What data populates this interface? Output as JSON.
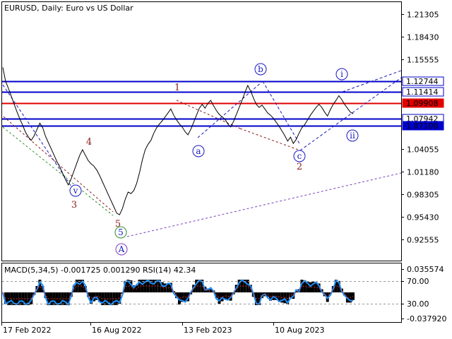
{
  "header": {
    "symbol_title": "EURUSD, Daily:  Euro vs US Dollar"
  },
  "indicator": {
    "title": "MACD(5,34,5) -0.001725 0.001290 RSI(14) 42.34",
    "ticks": [
      {
        "label": "0.035574",
        "value": 0.035574
      },
      {
        "label": "70.00",
        "value": 70
      },
      {
        "label": "30.00",
        "value": 30
      },
      {
        "label": "-0.037920",
        "value": -0.03792
      }
    ]
  },
  "colors": {
    "price_line": "#000000",
    "blue_level": "#0000cc",
    "red_level": "#e00000",
    "macd_histogram": "#000000",
    "rsi_line": "#1e90ff",
    "wave_dark": "#8b1a1a",
    "wave_blue": "#1818c0",
    "channel": "#7b3fbf"
  },
  "chart_data": [
    {
      "type": "line",
      "title": "EURUSD, Daily:  Euro vs US Dollar",
      "x_labels": [
        "17 Feb 2022",
        "16 Aug 2022",
        "13 Feb 2023",
        "10 Aug 2023"
      ],
      "y_ticks": [
        1.21305,
        1.1843,
        1.15555,
        1.04055,
        1.0118,
        0.98305,
        0.9543,
        0.92555
      ],
      "ylim": [
        0.9085,
        1.234
      ],
      "grid": false,
      "series": [
        {
          "values": [
            1.145,
            1.127,
            1.118,
            1.108,
            1.098,
            1.088,
            1.079,
            1.071,
            1.062,
            1.056,
            1.052,
            1.058,
            1.066,
            1.074,
            1.068,
            1.057,
            1.049,
            1.041,
            1.033,
            1.025,
            1.018,
            1.01,
            1.002,
            0.995,
            1.003,
            1.013,
            1.023,
            1.033,
            1.04,
            1.033,
            1.026,
            1.022,
            1.019,
            1.014,
            1.007,
            0.999,
            0.991,
            0.983,
            0.975,
            0.967,
            0.959,
            0.957,
            0.965,
            0.977,
            0.986,
            0.984,
            0.988,
            0.997,
            1.011,
            1.027,
            1.04,
            1.047,
            1.052,
            1.061,
            1.068,
            1.073,
            1.077,
            1.082,
            1.087,
            1.092,
            1.084,
            1.078,
            1.073,
            1.069,
            1.063,
            1.059,
            1.066,
            1.075,
            1.084,
            1.093,
            1.098,
            1.093,
            1.099,
            1.103,
            1.096,
            1.09,
            1.085,
            1.082,
            1.079,
            1.073,
            1.069,
            1.076,
            1.085,
            1.094,
            1.103,
            1.113,
            1.122,
            1.115,
            1.106,
            1.098,
            1.094,
            1.097,
            1.092,
            1.087,
            1.084,
            1.08,
            1.075,
            1.07,
            1.064,
            1.058,
            1.051,
            1.056,
            1.048,
            1.053,
            1.061,
            1.068,
            1.072,
            1.078,
            1.084,
            1.089,
            1.094,
            1.098,
            1.094,
            1.088,
            1.083,
            1.091,
            1.098,
            1.103,
            1.109,
            1.104,
            1.098,
            1.093,
            1.088,
            1.086
          ]
        }
      ],
      "levels": [
        {
          "label": "1.12744",
          "value": 1.12744,
          "color": "#0000cc",
          "tagged": false
        },
        {
          "label": "1.11414",
          "value": 1.11414,
          "color": "#0000cc",
          "tagged": false
        },
        {
          "label": "1.09908",
          "value": 1.09908,
          "color": "#e00000",
          "tagged": true
        },
        {
          "label": "1.07942",
          "value": 1.07942,
          "color": "#0000cc",
          "tagged": false
        },
        {
          "label": "1.07100",
          "value": 1.071,
          "color": "#0000cc",
          "tagged": true
        }
      ],
      "wave_labels": [
        {
          "text": "1",
          "style": "dark"
        },
        {
          "text": "2",
          "style": "dark"
        },
        {
          "text": "3",
          "style": "dark"
        },
        {
          "text": "4",
          "style": "dark"
        },
        {
          "text": "5",
          "style": "dark"
        },
        {
          "text": "5",
          "style": "green-circle"
        },
        {
          "text": "A",
          "style": "purple-circle"
        },
        {
          "text": "a",
          "style": "blue-circle"
        },
        {
          "text": "b",
          "style": "blue-circle"
        },
        {
          "text": "c",
          "style": "blue-circle"
        },
        {
          "text": "v",
          "style": "blue-circle"
        },
        {
          "text": "i",
          "style": "blue-circle"
        },
        {
          "text": "ii",
          "style": "blue-circle"
        }
      ]
    }
  ]
}
